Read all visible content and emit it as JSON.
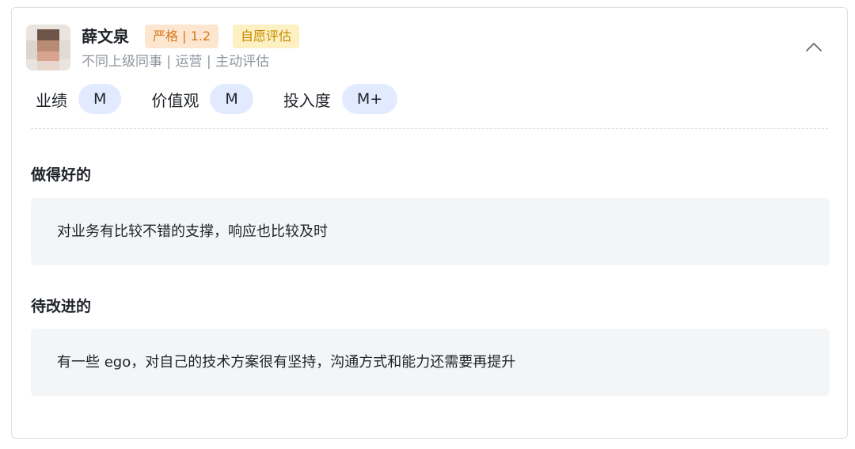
{
  "reviewer": {
    "name": "薛文泉",
    "tags": [
      {
        "label": "严格 | 1.2",
        "color": "#d9771a",
        "bg": "#fde6d0"
      },
      {
        "label": "自愿评估",
        "color": "#c78a00",
        "bg": "#fdf1c4"
      }
    ],
    "subinfo": "不同上级同事 | 运营 | 主动评估"
  },
  "ratings": [
    {
      "label": "业绩",
      "value": "M"
    },
    {
      "label": "价值观",
      "value": "M"
    },
    {
      "label": "投入度",
      "value": "M+"
    }
  ],
  "sections": [
    {
      "title": "做得好的",
      "content": "对业务有比较不错的支撑，响应也比较及时"
    },
    {
      "title": "待改进的",
      "content": "有一些 ego，对自己的技术方案很有坚持，沟通方式和能力还需要再提升"
    }
  ],
  "icons": {
    "collapse": "chevron-up-icon",
    "avatar": "avatar-image-blurred"
  },
  "colors": {
    "pill_bg": "#e1eaff",
    "box_bg": "#f4f5f7",
    "muted_text": "#8f959e"
  }
}
